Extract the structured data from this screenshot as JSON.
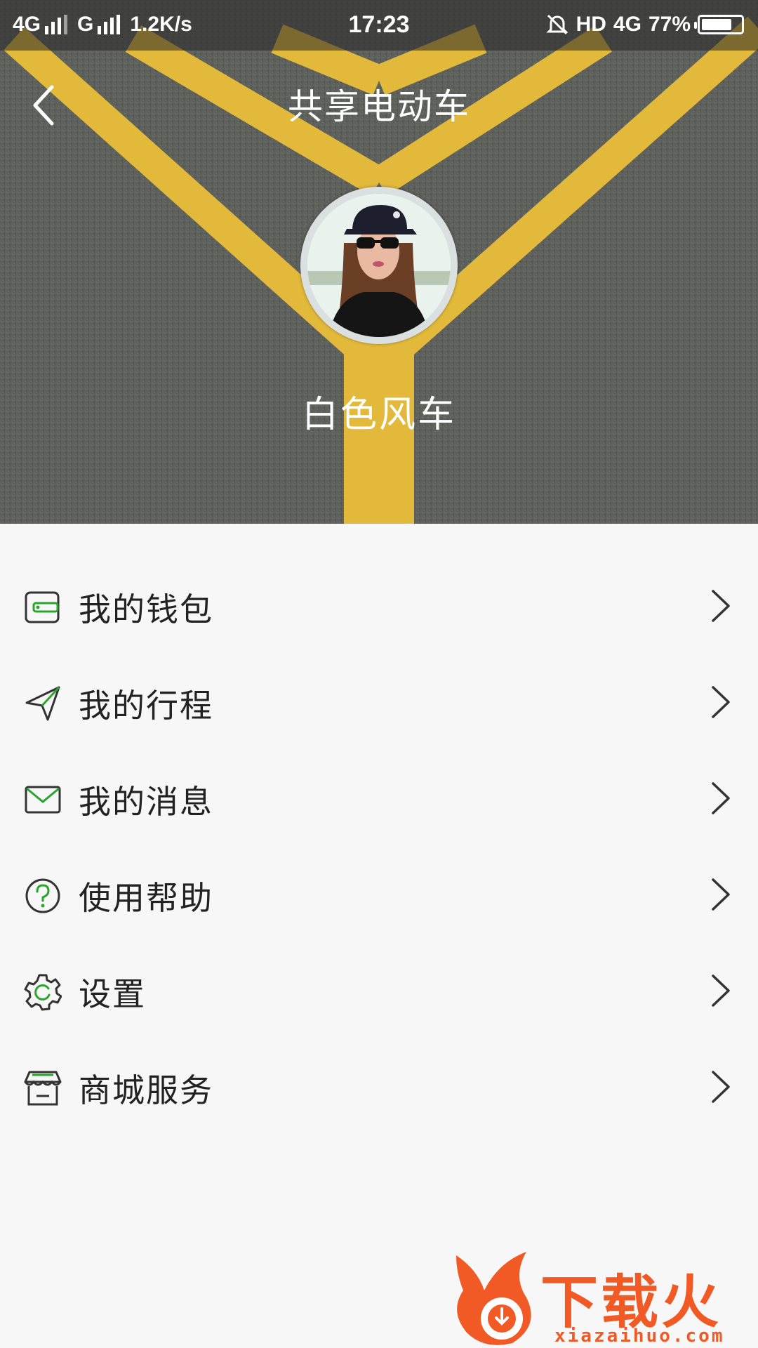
{
  "status_bar": {
    "net1": "4G",
    "net2": "G",
    "speed": "1.2K/s",
    "time": "17:23",
    "hd": "HD",
    "net3": "4G",
    "battery": "77%",
    "battery_level": 0.77
  },
  "header": {
    "title": "共享电动车"
  },
  "profile": {
    "username": "白色风车"
  },
  "menu": {
    "items": [
      {
        "label": "我的钱包",
        "icon": "wallet-icon"
      },
      {
        "label": "我的行程",
        "icon": "paper-plane-icon"
      },
      {
        "label": "我的消息",
        "icon": "envelope-icon"
      },
      {
        "label": "使用帮助",
        "icon": "question-icon"
      },
      {
        "label": "设置",
        "icon": "gear-icon"
      },
      {
        "label": "商城服务",
        "icon": "store-icon"
      }
    ]
  },
  "watermark": {
    "brand": "下载火",
    "url": "xiazaihuo.com"
  },
  "colors": {
    "accent_green": "#2ba42b",
    "road_yellow": "#e2b93b",
    "watermark_orange": "#f15a25"
  }
}
